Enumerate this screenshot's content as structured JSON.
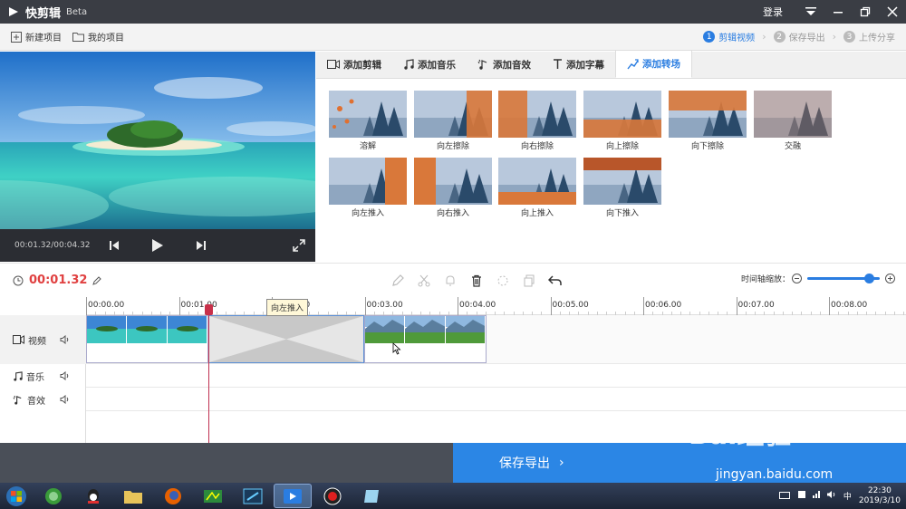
{
  "app": {
    "name": "快剪辑",
    "badge": "Beta",
    "login": "登录"
  },
  "toolbar": {
    "new_project": "新建项目",
    "my_projects": "我的项目"
  },
  "steps": [
    {
      "num": "1",
      "label": "剪辑视频"
    },
    {
      "num": "2",
      "label": "保存导出"
    },
    {
      "num": "3",
      "label": "上传分享"
    }
  ],
  "preview": {
    "time": "00:01.32/00:04.32"
  },
  "tabs": [
    "添加剪辑",
    "添加音乐",
    "添加音效",
    "添加字幕",
    "添加转场"
  ],
  "transitions": [
    "溶解",
    "向左擦除",
    "向右擦除",
    "向上擦除",
    "向下擦除",
    "交融",
    "向左推入",
    "向右推入",
    "向上推入",
    "向下推入"
  ],
  "timeline": {
    "current_time": "00:01.32",
    "zoom_label": "时间轴缩放：",
    "zoom_level": 0.85,
    "ticks": [
      "00:00.00",
      "00:01.00",
      "00:02.00",
      "00:03.00",
      "00:04.00",
      "00:05.00",
      "00:06.00",
      "00:07.00",
      "00:08.00"
    ],
    "tooltip": "向左推入",
    "tracks": {
      "video": "视频",
      "music": "音乐",
      "sfx": "音效"
    }
  },
  "export": {
    "label": "保存导出"
  },
  "taskbar": {
    "time": "22:30",
    "date": "2019/3/10"
  },
  "watermark": {
    "text": "Bai经验",
    "url": "jingyan.baidu.com"
  },
  "colors": {
    "accent": "#2a7de1",
    "titlebar": "#3a3d44",
    "time_red": "#e04040"
  }
}
